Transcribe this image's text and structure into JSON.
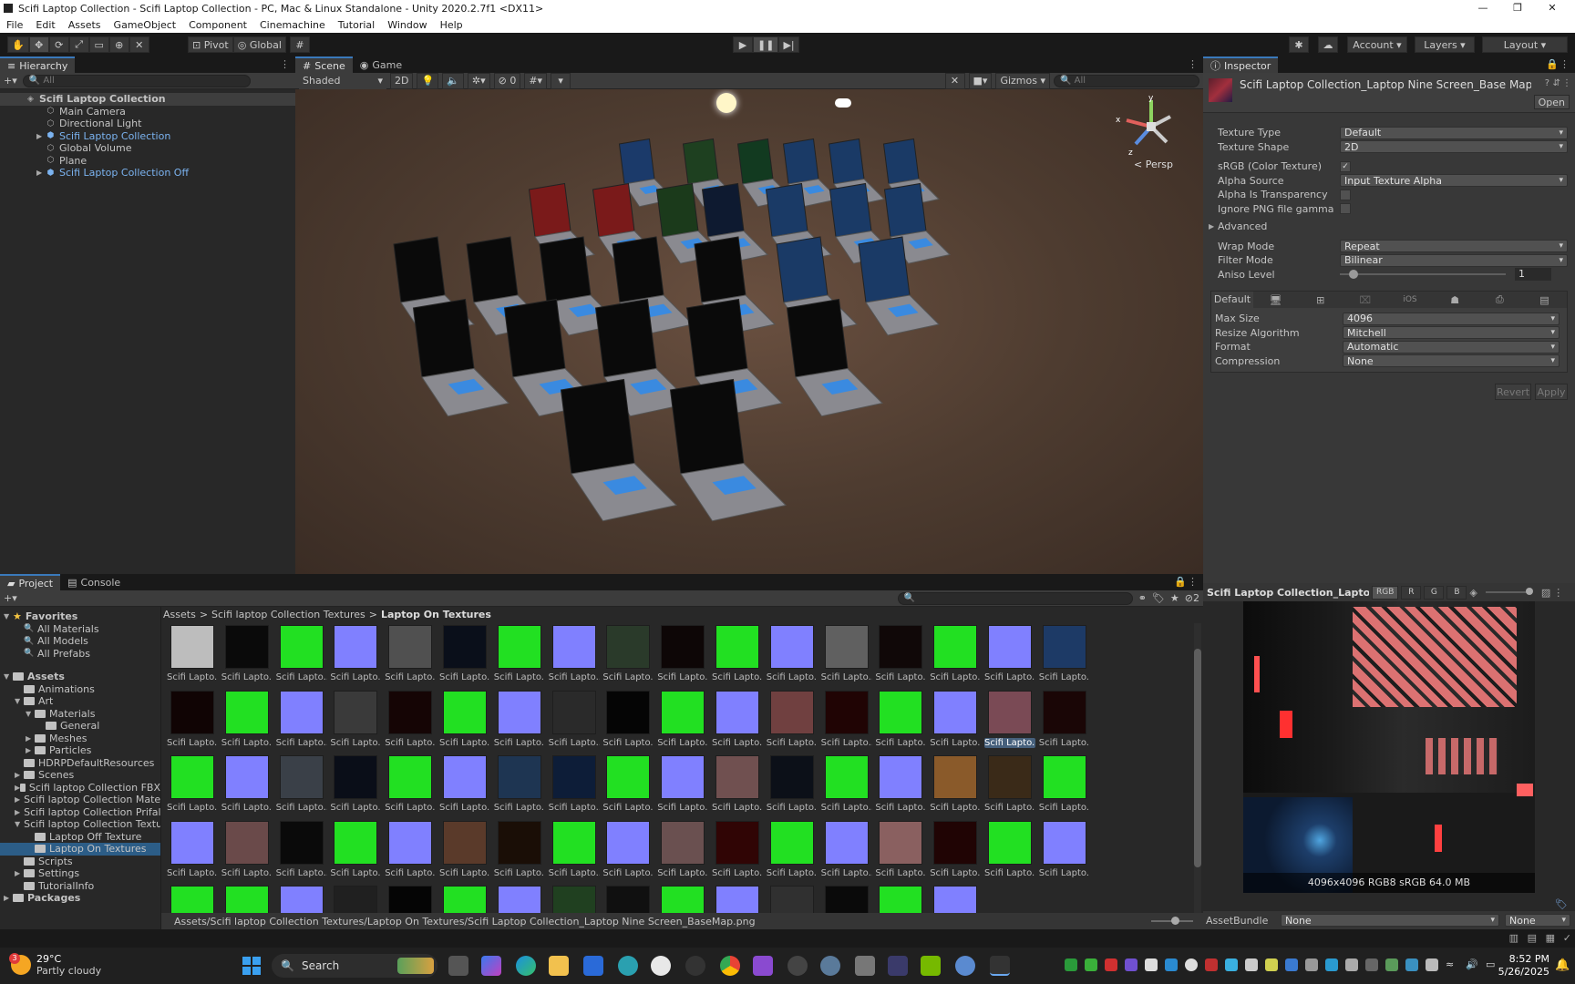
{
  "window": {
    "title": "Scifi Laptop Collection - Scifi Laptop Collection - PC, Mac & Linux Standalone - Unity 2020.2.7f1 <DX11>",
    "controls": [
      "—",
      "❐",
      "✕"
    ]
  },
  "menu": [
    "File",
    "Edit",
    "Assets",
    "GameObject",
    "Component",
    "Cinemachine",
    "Tutorial",
    "Window",
    "Help"
  ],
  "toolbar": {
    "tools": [
      "hand-tool-icon",
      "move-tool-icon",
      "rotate-tool-icon",
      "scale-tool-icon",
      "rect-tool-icon",
      "transform-tool-icon",
      "custom-tool-icon"
    ],
    "pivot_label": "Pivot",
    "global_label": "Global",
    "account_label": "Account",
    "layers_label": "Layers",
    "layout_label": "Layout"
  },
  "hierarchy": {
    "tab_label": "Hierarchy",
    "search_placeholder": "All",
    "scene_name": "Scifi Laptop Collection",
    "items": [
      {
        "label": "Main Camera",
        "type": "go"
      },
      {
        "label": "Directional Light",
        "type": "go"
      },
      {
        "label": "Scifi Laptop Collection",
        "type": "prefab"
      },
      {
        "label": "Global Volume",
        "type": "go"
      },
      {
        "label": "Plane",
        "type": "go"
      },
      {
        "label": "Scifi Laptop Collection Off",
        "type": "prefab"
      }
    ]
  },
  "scene": {
    "tabs": [
      "Scene",
      "Game"
    ],
    "shading_mode": "Shaded",
    "mode_2d": "2D",
    "hidden_count": "0",
    "gizmos_label": "Gizmos",
    "search_placeholder": "All",
    "persp_label": "< Persp",
    "axis_labels": {
      "x": "x",
      "y": "y",
      "z": "z"
    }
  },
  "inspector": {
    "tab_label": "Inspector",
    "asset_title": "Scifi Laptop Collection_Laptop Nine Screen_Base Map (Textu",
    "open_label": "Open",
    "fields": [
      {
        "label": "Texture Type",
        "value": "Default",
        "kind": "dropdown"
      },
      {
        "label": "Texture Shape",
        "value": "2D",
        "kind": "dropdown"
      },
      {
        "label": "sRGB (Color Texture)",
        "value": "✓",
        "kind": "checkbox"
      },
      {
        "label": "Alpha Source",
        "value": "Input Texture Alpha",
        "kind": "dropdown"
      },
      {
        "label": "Alpha Is Transparency",
        "value": "",
        "kind": "checkbox"
      },
      {
        "label": "Ignore PNG file gamma",
        "value": "",
        "kind": "checkbox"
      }
    ],
    "advanced_label": "Advanced",
    "wrap_fields": [
      {
        "label": "Wrap Mode",
        "value": "Repeat"
      },
      {
        "label": "Filter Mode",
        "value": "Bilinear"
      }
    ],
    "aniso_label": "Aniso Level",
    "aniso_value": "1",
    "platform_tab_default": "Default",
    "platform_fields": [
      {
        "label": "Max Size",
        "value": "4096"
      },
      {
        "label": "Resize Algorithm",
        "value": "Mitchell"
      },
      {
        "label": "Format",
        "value": "Automatic"
      },
      {
        "label": "Compression",
        "value": "None"
      }
    ],
    "revert_label": "Revert",
    "apply_label": "Apply"
  },
  "preview": {
    "title": "Scifi Laptop Collection_Laptop Nine",
    "channels": [
      "RGB",
      "R",
      "G",
      "B"
    ],
    "info": "4096x4096  RGB8 sRGB   64.0 MB",
    "assetbundle_label": "AssetBundle",
    "assetbundle_value": "None",
    "variant_value": "None"
  },
  "project": {
    "tabs": [
      "Project",
      "Console"
    ],
    "favorites_label": "Favorites",
    "favorites": [
      "All Materials",
      "All Models",
      "All Prefabs"
    ],
    "assets_label": "Assets",
    "tree": [
      {
        "label": "Animations",
        "depth": 1
      },
      {
        "label": "Art",
        "depth": 1,
        "open": true
      },
      {
        "label": "Materials",
        "depth": 2,
        "open": true
      },
      {
        "label": "General",
        "depth": 3
      },
      {
        "label": "Meshes",
        "depth": 2
      },
      {
        "label": "Particles",
        "depth": 2
      },
      {
        "label": "HDRPDefaultResources",
        "depth": 1
      },
      {
        "label": "Scenes",
        "depth": 1
      },
      {
        "label": "Scifi laptop Collection FBX",
        "depth": 1
      },
      {
        "label": "Scifi laptop Collection Mate",
        "depth": 1
      },
      {
        "label": "Scifi laptop Collection Prifal",
        "depth": 1
      },
      {
        "label": "Scifi laptop Collection Textu",
        "depth": 1,
        "open": true
      },
      {
        "label": "Laptop Off Texture",
        "depth": 2
      },
      {
        "label": "Laptop On Textures",
        "depth": 2,
        "selected": true
      },
      {
        "label": "Scripts",
        "depth": 1
      },
      {
        "label": "Settings",
        "depth": 1
      },
      {
        "label": "TutorialInfo",
        "depth": 1
      }
    ],
    "packages_label": "Packages",
    "breadcrumb": [
      "Assets",
      "Scifi laptop Collection Textures",
      "Laptop On Textures"
    ],
    "thumb_caption": "Scifi Lapto...",
    "hidden_count": "2",
    "status_path": "Assets/Scifi laptop Collection Textures/Laptop On Textures/Scifi Laptop Collection_Laptop Nine Screen_BaseMap.png",
    "thumb_colors": [
      [
        "#bdbdbd",
        "#0a0a0a",
        "#22e022",
        "#8080ff",
        "#505050",
        "#0a0f1a",
        "#22e022",
        "#8080ff",
        "#2a3a2a",
        "#0d0606",
        "#22e022",
        "#8080ff",
        "#606060",
        "#100808",
        "#22e022",
        "#8080ff",
        "#1d3a66"
      ],
      [
        "#100404",
        "#22e022",
        "#8080ff",
        "#3a3a3a",
        "#150505",
        "#22e022",
        "#8080ff",
        "#2a2a2a",
        "#050505",
        "#22e022",
        "#8080ff",
        "#704040",
        "#200404",
        "#22e022",
        "#8080ff",
        "#7a4a55",
        "#1a0606"
      ],
      [
        "#22e022",
        "#8080ff",
        "#3a4048",
        "#0a0e18",
        "#22e022",
        "#8080ff",
        "#1e3552",
        "#0d1d38",
        "#22e022",
        "#8080ff",
        "#705050",
        "#0c1018",
        "#22e022",
        "#8080ff",
        "#8a5a2a",
        "#3a2a18",
        "#22e022"
      ],
      [
        "#8080ff",
        "#6a4a4a",
        "#0a0a0a",
        "#22e022",
        "#8080ff",
        "#5a3a2a",
        "#1a0e06",
        "#22e022",
        "#8080ff",
        "#6a5050",
        "#300505",
        "#22e022",
        "#8080ff",
        "#8a6060",
        "#200404",
        "#22e022",
        "#8080ff"
      ],
      [
        "#22e022",
        "#22e022",
        "#8080ff",
        "#202020",
        "#050505",
        "#22e022",
        "#8080ff",
        "#204020",
        "#101010",
        "#22e022",
        "#8080ff",
        "#303030",
        "#0a0a0a",
        "#22e022",
        "#8080ff"
      ]
    ]
  },
  "taskbar": {
    "weather_temp": "29°C",
    "weather_desc": "Partly cloudy",
    "weather_badge": "3",
    "search_label": "Search",
    "time": "8:52 PM",
    "date": "5/26/2025"
  }
}
